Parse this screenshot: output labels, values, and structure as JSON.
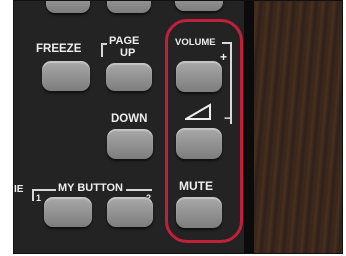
{
  "labels": {
    "freeze": "FREEZE",
    "page": "PAGE",
    "up": "UP",
    "down": "DOWN",
    "volume": "VOLUME",
    "plus": "+",
    "minus": "−",
    "ramp": "◿",
    "mute": "MUTE",
    "my_button": "MY BUTTON",
    "one": "1",
    "two": "2",
    "left_fragment": "IE"
  },
  "colors": {
    "highlight": "#c0203a",
    "remote_body": "#232323",
    "button": "#8f8f8f"
  }
}
